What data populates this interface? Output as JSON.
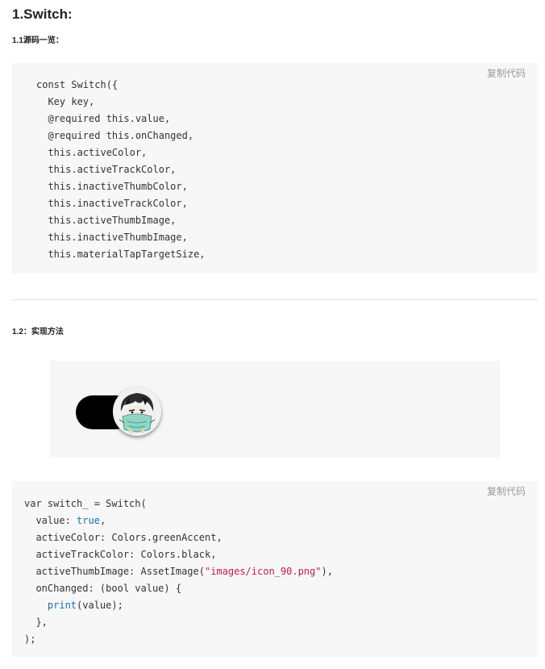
{
  "heading1": "1.Switch:",
  "section1": {
    "title": "1.1源码一览：",
    "copy_label": "复制代码",
    "lines": [
      "const Switch({",
      "  Key key,",
      "  @required this.value,",
      "  @required this.onChanged,",
      "  this.activeColor,",
      "  this.activeTrackColor,",
      "  this.inactiveThumbColor,",
      "  this.inactiveTrackColor,",
      "  this.activeThumbImage,",
      "  this.inactiveThumbImage,",
      "  this.materialTapTargetSize,"
    ]
  },
  "section2": {
    "title": "1.2：实现方法",
    "copy_label": "复制代码",
    "lines": [
      "var switch_ = Switch(",
      "  value: ",
      "true",
      ",",
      "  activeColor: Colors.greenAccent,",
      "  activeTrackColor: Colors.black,",
      "  activeThumbImage: AssetImage(",
      "\"images/icon_90.png\"",
      "),",
      "  onChanged: (bool value) {",
      "    ",
      "print",
      "(value);",
      "  },",
      ");"
    ]
  },
  "demo": {
    "switch_value": 1,
    "track_color": "#000000",
    "thumb_image": "avatar-icon"
  },
  "colors": {
    "keyword": "#1a6fa8",
    "string": "#c41a4b",
    "code_bg": "#f7f7f7",
    "copy_text": "#9a9a9a"
  }
}
